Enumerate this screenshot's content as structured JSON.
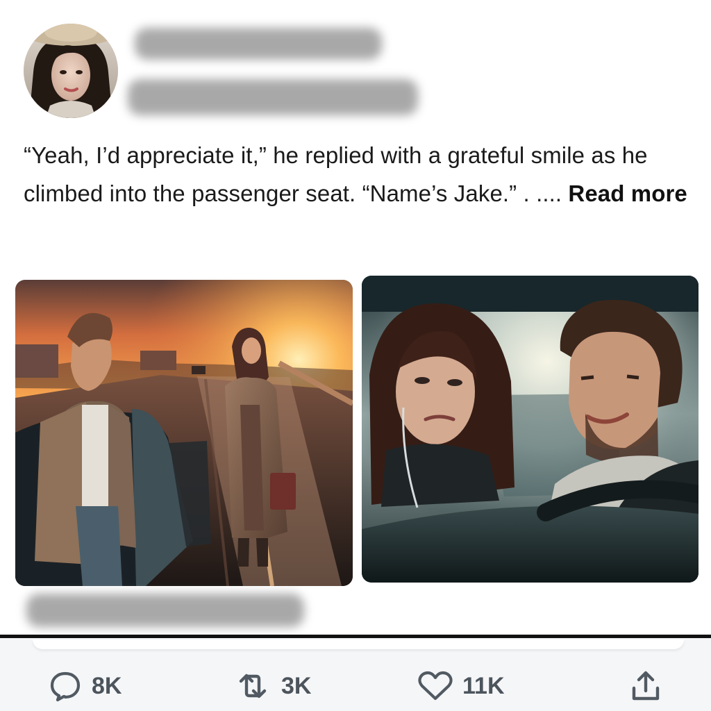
{
  "post": {
    "text": "“Yeah, I’d appreciate it,” he replied with a grateful smile as he climbed into the passenger seat. “Name’s Jake.” . .... ",
    "read_more": "Read more"
  },
  "actions": [
    {
      "name": "reply",
      "icon": "comment-icon",
      "count": "8K"
    },
    {
      "name": "repost",
      "icon": "repost-icon",
      "count": "3K"
    },
    {
      "name": "like",
      "icon": "heart-icon",
      "count": "11K"
    },
    {
      "name": "share",
      "icon": "share-icon"
    }
  ]
}
